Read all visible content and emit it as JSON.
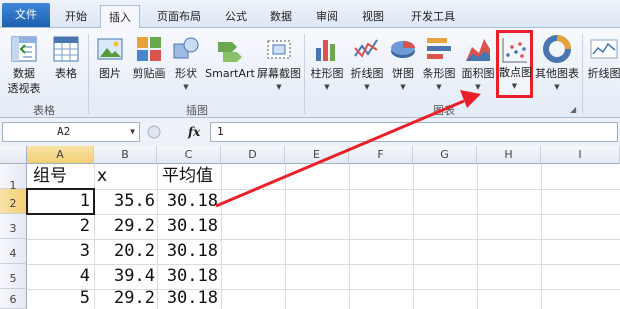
{
  "tabs": [
    "文件",
    "开始",
    "插入",
    "页面布局",
    "公式",
    "数据",
    "审阅",
    "视图",
    "开发工具"
  ],
  "ribbon": {
    "pivot_table": [
      "数据",
      "透视表"
    ],
    "table": "表格",
    "picture": "图片",
    "clip_art": "剪贴画",
    "shapes": "形状",
    "smartart": "SmartArt",
    "screenshot": "屏幕截图",
    "column_chart": "柱形图",
    "line_chart": "折线图",
    "pie_chart": "饼图",
    "bar_chart": "条形图",
    "area_chart": "面积图",
    "scatter_chart": "散点图",
    "other_charts": "其他图表",
    "sparkline_line": "折线图",
    "groups": {
      "tables": "表格",
      "illustrations": "插图",
      "charts": "图表"
    }
  },
  "formula_bar": {
    "name_box": "A2",
    "fx": "fx",
    "content": "1"
  },
  "columns": [
    "A",
    "B",
    "C",
    "D",
    "E",
    "F",
    "G",
    "H",
    "I"
  ],
  "rows": [
    "1",
    "2",
    "3",
    "4",
    "5",
    "6"
  ],
  "table": {
    "headers": [
      "组号",
      "x",
      "平均值"
    ],
    "data": [
      [
        "1",
        "35.6",
        "30.18"
      ],
      [
        "2",
        "29.2",
        "30.18"
      ],
      [
        "3",
        "20.2",
        "30.18"
      ],
      [
        "4",
        "39.4",
        "30.18"
      ],
      [
        "5",
        "29.2",
        "30.18"
      ]
    ]
  },
  "colors": {
    "highlight": "#e8202a",
    "file_tab": "#2a6ebd",
    "selection": "#f2cf74"
  }
}
